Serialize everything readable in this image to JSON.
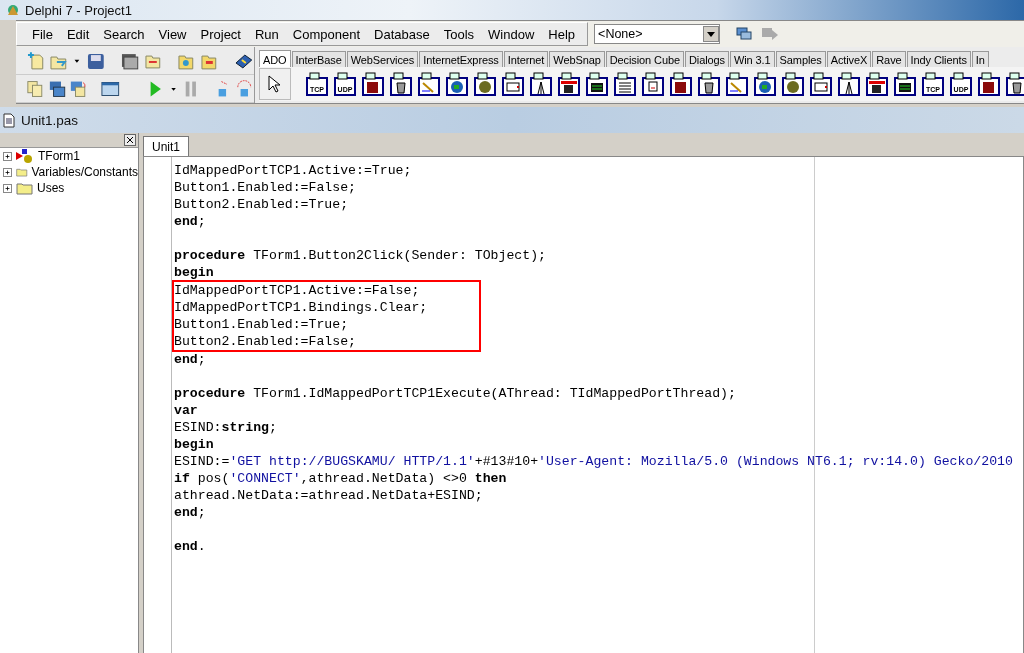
{
  "window": {
    "title": "Delphi 7 - Project1"
  },
  "menu": [
    "File",
    "Edit",
    "Search",
    "View",
    "Project",
    "Run",
    "Component",
    "Database",
    "Tools",
    "Window",
    "Help"
  ],
  "desktop_dropdown": {
    "value": "<None>"
  },
  "palette_tabs": [
    {
      "label": "ADO",
      "selected": true
    },
    {
      "label": "InterBase",
      "selected": false
    },
    {
      "label": "WebServices",
      "selected": false
    },
    {
      "label": "InternetExpress",
      "selected": false
    },
    {
      "label": "Internet",
      "selected": false
    },
    {
      "label": "WebSnap",
      "selected": false
    },
    {
      "label": "Decision Cube",
      "selected": false
    },
    {
      "label": "Dialogs",
      "selected": false
    },
    {
      "label": "Win 3.1",
      "selected": false
    },
    {
      "label": "Samples",
      "selected": false
    },
    {
      "label": "ActiveX",
      "selected": false
    },
    {
      "label": "Rave",
      "selected": false
    },
    {
      "label": "Indy Clients",
      "selected": false
    },
    {
      "label": "In",
      "selected": false
    }
  ],
  "palette_components": [
    {
      "kind": "labeled",
      "label": "TCP"
    },
    {
      "kind": "labeled",
      "label": "UDP"
    },
    {
      "kind": "glyph"
    },
    {
      "kind": "glyph"
    },
    {
      "kind": "glyph"
    },
    {
      "kind": "glyph"
    },
    {
      "kind": "glyph"
    },
    {
      "kind": "glyph"
    },
    {
      "kind": "glyph"
    },
    {
      "kind": "glyph"
    },
    {
      "kind": "glyph"
    },
    {
      "kind": "glyph"
    },
    {
      "kind": "glyph"
    },
    {
      "kind": "glyph"
    },
    {
      "kind": "glyph"
    },
    {
      "kind": "glyph"
    },
    {
      "kind": "glyph"
    },
    {
      "kind": "glyph"
    },
    {
      "kind": "glyph"
    },
    {
      "kind": "glyph"
    },
    {
      "kind": "glyph"
    },
    {
      "kind": "glyph"
    },
    {
      "kind": "labeled",
      "label": "TCP"
    },
    {
      "kind": "labeled",
      "label": "UDP"
    },
    {
      "kind": "glyph"
    },
    {
      "kind": "glyph"
    }
  ],
  "editor_window": {
    "title": "Unit1.pas"
  },
  "explorer": {
    "items": [
      {
        "label": "TForm1",
        "kind": "form",
        "expanded": false
      },
      {
        "label": "Variables/Constants",
        "kind": "folder",
        "expanded": false
      },
      {
        "label": "Uses",
        "kind": "folder",
        "expanded": false
      }
    ]
  },
  "editor_tabs": [
    {
      "label": "Unit1",
      "selected": true
    }
  ],
  "code_blocks": [
    {
      "lines": [
        {
          "highlighted": false,
          "tokens": [
            {
              "text": "IdMappedPortTCP1.Active:=True;",
              "kind": "plain"
            }
          ]
        },
        {
          "highlighted": false,
          "tokens": [
            {
              "text": "Button1.Enabled:=False;",
              "kind": "plain"
            }
          ]
        },
        {
          "highlighted": false,
          "tokens": [
            {
              "text": "Button2.Enabled:=True;",
              "kind": "plain"
            }
          ]
        },
        {
          "highlighted": false,
          "tokens": [
            {
              "text": "end",
              "kind": "keyword"
            },
            {
              "text": ";",
              "kind": "plain"
            }
          ]
        }
      ]
    },
    {
      "lines": [
        {
          "highlighted": false,
          "tokens": [
            {
              "text": "procedure",
              "kind": "keyword"
            },
            {
              "text": " TForm1.Button2Click(Sender: TObject);",
              "kind": "plain"
            }
          ]
        },
        {
          "highlighted": false,
          "tokens": [
            {
              "text": "begin",
              "kind": "keyword"
            }
          ]
        },
        {
          "highlighted": true,
          "tokens": [
            {
              "text": "IdMappedPortTCP1.Active:=False;",
              "kind": "plain"
            }
          ]
        },
        {
          "highlighted": true,
          "tokens": [
            {
              "text": "IdMappedPortTCP1.Bindings.Clear;",
              "kind": "plain"
            }
          ]
        },
        {
          "highlighted": true,
          "tokens": [
            {
              "text": "Button1.Enabled:=True;",
              "kind": "plain"
            }
          ]
        },
        {
          "highlighted": true,
          "tokens": [
            {
              "text": "Button2.Enabled:=False;",
              "kind": "plain"
            }
          ]
        },
        {
          "highlighted": false,
          "tokens": [
            {
              "text": "end",
              "kind": "keyword"
            },
            {
              "text": ";",
              "kind": "plain"
            }
          ]
        }
      ]
    },
    {
      "lines": [
        {
          "highlighted": false,
          "tokens": [
            {
              "text": "procedure",
              "kind": "keyword"
            },
            {
              "text": " TForm1.IdMappedPortTCP1Execute(AThread: TIdMappedPortThread);",
              "kind": "plain"
            }
          ]
        },
        {
          "highlighted": false,
          "tokens": [
            {
              "text": "var",
              "kind": "keyword"
            }
          ]
        },
        {
          "highlighted": false,
          "tokens": [
            {
              "text": "ESIND:",
              "kind": "plain"
            },
            {
              "text": "string",
              "kind": "keyword"
            },
            {
              "text": ";",
              "kind": "plain"
            }
          ]
        },
        {
          "highlighted": false,
          "tokens": [
            {
              "text": "begin",
              "kind": "keyword"
            }
          ]
        },
        {
          "highlighted": false,
          "tokens": [
            {
              "text": "ESIND:=",
              "kind": "plain"
            },
            {
              "text": "'GET http://BUGSKAMU/ HTTP/1.1'",
              "kind": "string"
            },
            {
              "text": "+#13#10+",
              "kind": "plain"
            },
            {
              "text": "'User-Agent: Mozilla/5.0 (Windows NT6.1; rv:14.0) Gecko/2010",
              "kind": "string"
            }
          ]
        },
        {
          "highlighted": false,
          "tokens": [
            {
              "text": "if",
              "kind": "keyword"
            },
            {
              "text": " pos(",
              "kind": "plain"
            },
            {
              "text": "'CONNECT'",
              "kind": "string"
            },
            {
              "text": ",athread.NetData) <>0 ",
              "kind": "plain"
            },
            {
              "text": "then",
              "kind": "keyword"
            }
          ]
        },
        {
          "highlighted": false,
          "tokens": [
            {
              "text": "athread.NetData:=athread.NetData+ESIND;",
              "kind": "plain"
            }
          ]
        },
        {
          "highlighted": false,
          "tokens": [
            {
              "text": "end",
              "kind": "keyword"
            },
            {
              "text": ";",
              "kind": "plain"
            }
          ]
        }
      ]
    },
    {
      "lines": [
        {
          "highlighted": false,
          "tokens": [
            {
              "text": "end",
              "kind": "keyword"
            },
            {
              "text": ".",
              "kind": "plain"
            }
          ]
        }
      ]
    }
  ]
}
